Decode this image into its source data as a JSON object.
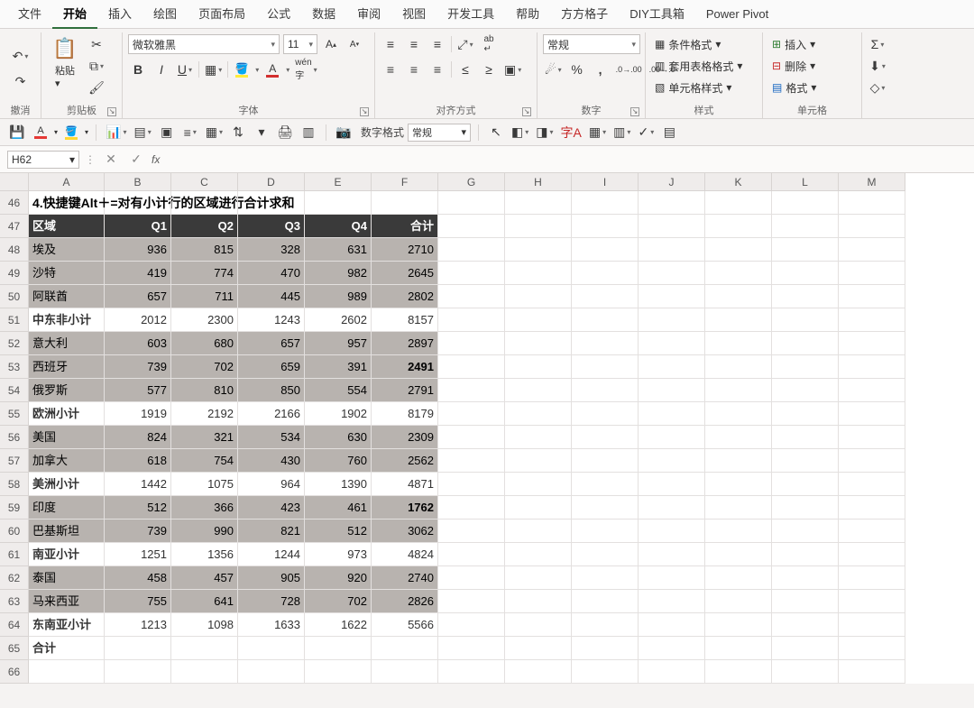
{
  "menubar": {
    "tabs": [
      "文件",
      "开始",
      "插入",
      "绘图",
      "页面布局",
      "公式",
      "数据",
      "审阅",
      "视图",
      "开发工具",
      "帮助",
      "方方格子",
      "DIY工具箱",
      "Power Pivot"
    ],
    "active_index": 1
  },
  "ribbon": {
    "undo_label": "撤消",
    "clipboard_label": "剪贴板",
    "paste_label": "粘贴",
    "font_label": "字体",
    "font_name": "微软雅黑",
    "font_size": "11",
    "align_label": "对齐方式",
    "number_label": "数字",
    "number_format": "常规",
    "styles_label": "样式",
    "cond_fmt": "条件格式",
    "fmt_as_table": "套用表格格式",
    "cell_styles": "单元格样式",
    "cells_label": "单元格",
    "insert": "插入",
    "delete": "删除",
    "format": "格式"
  },
  "qat": {
    "num_format_label": "数字格式",
    "num_format_value": "常规"
  },
  "namebox": "H62",
  "fx": "",
  "columns": [
    "A",
    "B",
    "C",
    "D",
    "E",
    "F",
    "G",
    "H",
    "I",
    "J",
    "K",
    "L",
    "M"
  ],
  "row_start": 46,
  "title": "4.快捷键Alt＋=对有小计行的区域进行合计求和",
  "headers": [
    "区域",
    "Q1",
    "Q2",
    "Q3",
    "Q4",
    "合计"
  ],
  "chart_data": {
    "type": "table",
    "rows": [
      {
        "kind": "data",
        "label": "埃及",
        "v": [
          936,
          815,
          328,
          631,
          2710
        ]
      },
      {
        "kind": "data",
        "label": "沙特",
        "v": [
          419,
          774,
          470,
          982,
          2645
        ]
      },
      {
        "kind": "data",
        "label": "阿联酋",
        "v": [
          657,
          711,
          445,
          989,
          2802
        ]
      },
      {
        "kind": "sub",
        "label": "中东非小计",
        "v": [
          2012,
          2300,
          1243,
          2602,
          8157
        ]
      },
      {
        "kind": "data",
        "label": "意大利",
        "v": [
          603,
          680,
          657,
          957,
          2897
        ]
      },
      {
        "kind": "data",
        "label": "西班牙",
        "v": [
          739,
          702,
          659,
          391,
          2491
        ],
        "bold_total": true
      },
      {
        "kind": "data",
        "label": "俄罗斯",
        "v": [
          577,
          810,
          850,
          554,
          2791
        ]
      },
      {
        "kind": "sub",
        "label": "欧洲小计",
        "v": [
          1919,
          2192,
          2166,
          1902,
          8179
        ]
      },
      {
        "kind": "data",
        "label": "美国",
        "v": [
          824,
          321,
          534,
          630,
          2309
        ]
      },
      {
        "kind": "data",
        "label": "加拿大",
        "v": [
          618,
          754,
          430,
          760,
          2562
        ]
      },
      {
        "kind": "sub",
        "label": "美洲小计",
        "v": [
          1442,
          1075,
          964,
          1390,
          4871
        ]
      },
      {
        "kind": "data",
        "label": "印度",
        "v": [
          512,
          366,
          423,
          461,
          1762
        ],
        "bold_total": true
      },
      {
        "kind": "data",
        "label": "巴基斯坦",
        "v": [
          739,
          990,
          821,
          512,
          3062
        ]
      },
      {
        "kind": "sub",
        "label": "南亚小计",
        "v": [
          1251,
          1356,
          1244,
          973,
          4824
        ]
      },
      {
        "kind": "data",
        "label": "泰国",
        "v": [
          458,
          457,
          905,
          920,
          2740
        ]
      },
      {
        "kind": "data",
        "label": "马来西亚",
        "v": [
          755,
          641,
          728,
          702,
          2826
        ]
      },
      {
        "kind": "sub",
        "label": "东南亚小计",
        "v": [
          1213,
          1098,
          1633,
          1622,
          5566
        ]
      },
      {
        "kind": "total",
        "label": "合计",
        "v": [
          "",
          "",
          "",
          "",
          ""
        ]
      }
    ]
  }
}
